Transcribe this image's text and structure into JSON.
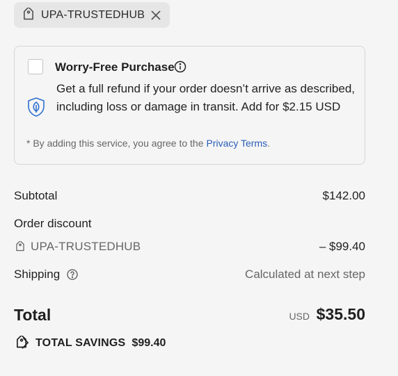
{
  "discount_chip": {
    "code": "UPA-TRUSTEDHUB",
    "remove_icon": "close-icon",
    "tag_icon": "tag-icon"
  },
  "worry_free": {
    "title": "Worry-Free Purchase",
    "description": "Get a full refund if your order doesn’t arrive as described, including loss or damage in transit. Add for $2.15 USD",
    "note": "* By adding this service, you agree to the",
    "link": "Privacy Terms",
    "note_end": ".",
    "checked": false,
    "shield_color": "#2f6fcf"
  },
  "summary": {
    "subtotal_label": "Subtotal",
    "subtotal_value": "$142.00",
    "discount_label": "Order discount",
    "discount_code": "UPA-TRUSTEDHUB",
    "discount_value": "– $99.40",
    "shipping_label": "Shipping",
    "shipping_value": "Calculated at next step",
    "total_label": "Total",
    "total_currency": "USD",
    "total_value": "$35.50",
    "savings_label": "TOTAL SAVINGS",
    "savings_value": "$99.40"
  }
}
